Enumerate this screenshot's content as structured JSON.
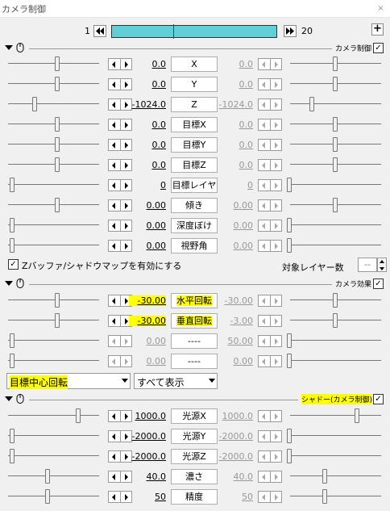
{
  "window": {
    "title": "カメラ制御",
    "close": "×"
  },
  "frame": {
    "start": "1",
    "end": "20",
    "add": "+"
  },
  "camera_section": {
    "label": "カメラ制御",
    "checked": "✓"
  },
  "camera_rows": [
    {
      "name": "X",
      "left": "0.0",
      "right": "0.0"
    },
    {
      "name": "Y",
      "left": "0.0",
      "right": "0.0"
    },
    {
      "name": "Z",
      "left": "-1024.0",
      "right": "-1024.0"
    },
    {
      "name": "目標X",
      "left": "0.0",
      "right": "0.0"
    },
    {
      "name": "目標Y",
      "left": "0.0",
      "right": "0.0"
    },
    {
      "name": "目標Z",
      "left": "0.0",
      "right": "0.0"
    },
    {
      "name": "目標レイヤ",
      "left": "0",
      "right": "0"
    },
    {
      "name": "傾き",
      "left": "0.00",
      "right": "0.00"
    },
    {
      "name": "深度ぼけ",
      "left": "0.00",
      "right": "0.00"
    },
    {
      "name": "視野角",
      "left": "0.00",
      "right": "0.00"
    }
  ],
  "zbuffer": {
    "label": "Zバッファ/シャドウマップを有効にする",
    "checked": "✓",
    "layer_label": "対象レイヤー数",
    "layer_value": "--"
  },
  "effect_section": {
    "label": "カメラ効果",
    "checked": "✓"
  },
  "effect_rows": [
    {
      "name": "水平回転",
      "left": "-30.00",
      "right": "-30.00"
    },
    {
      "name": "垂直回転",
      "left": "-30.00",
      "right": "-3.00"
    },
    {
      "name": "----",
      "left": "0.00",
      "right": "50.00"
    },
    {
      "name": "----",
      "left": "0.00",
      "right": "0.00"
    }
  ],
  "mode_select": {
    "value": "目標中心回転"
  },
  "display_select": {
    "value": "すべて表示"
  },
  "shadow_section": {
    "label": "シャドー(カメラ制御)",
    "checked": "✓"
  },
  "shadow_rows": [
    {
      "name": "光源X",
      "left": "1000.0",
      "right": "1000.0"
    },
    {
      "name": "光源Y",
      "left": "-2000.0",
      "right": "-2000.0"
    },
    {
      "name": "光源Z",
      "left": "-2000.0",
      "right": "-2000.0"
    },
    {
      "name": "濃さ",
      "left": "40.0",
      "right": "40.0"
    },
    {
      "name": "精度",
      "left": "50",
      "right": "50"
    }
  ],
  "colors": {
    "timeline": "#5fd0d8",
    "cursor": "#e00000",
    "highlight": "#ffff00"
  }
}
